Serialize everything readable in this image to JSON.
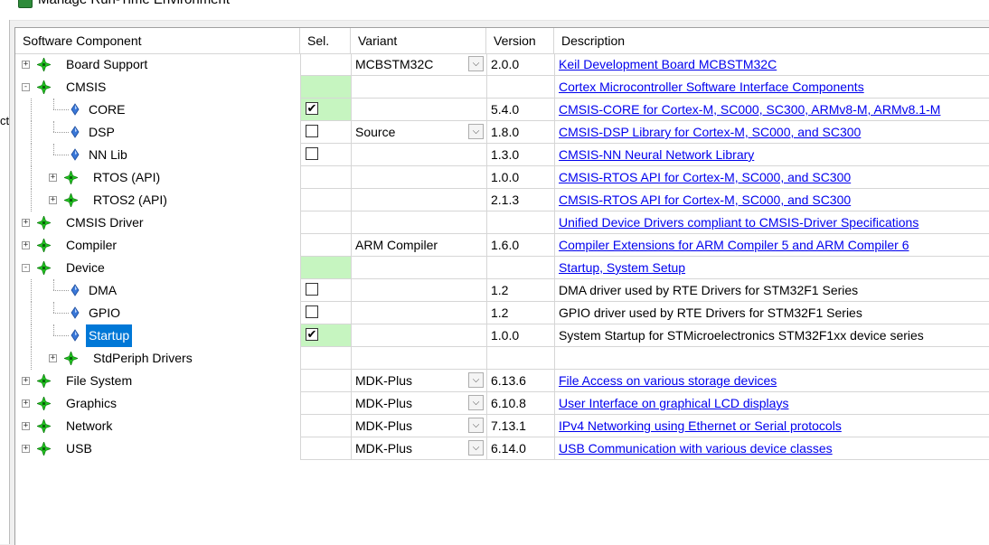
{
  "window": {
    "title": "Manage Run-Time Environment"
  },
  "left_fragment": "ct",
  "columns": {
    "component": "Software Component",
    "sel": "Sel.",
    "variant": "Variant",
    "version": "Version",
    "description": "Description"
  },
  "rows": [
    {
      "name": "Board Support",
      "level": 0,
      "type": "group",
      "expander": "+",
      "sel": "none",
      "variant": "MCBSTM32C",
      "dropdown": true,
      "version": "2.0.0",
      "description": "Keil Development Board MCBSTM32C",
      "link": true
    },
    {
      "name": "CMSIS",
      "level": 0,
      "type": "group",
      "expander": "-",
      "sel": "green",
      "variant": "",
      "dropdown": false,
      "version": "",
      "description": "Cortex Microcontroller Software Interface Components",
      "link": true
    },
    {
      "name": "CORE",
      "level": 1,
      "type": "leaf",
      "expander": "",
      "sel": "checked-green",
      "variant": "",
      "dropdown": false,
      "version": "5.4.0",
      "description": "CMSIS-CORE for Cortex-M, SC000, SC300, ARMv8-M, ARMv8.1-M",
      "link": true
    },
    {
      "name": "DSP",
      "level": 1,
      "type": "leaf",
      "expander": "",
      "sel": "unchecked",
      "variant": "Source",
      "dropdown": true,
      "version": "1.8.0",
      "description": "CMSIS-DSP Library for Cortex-M, SC000, and SC300",
      "link": true
    },
    {
      "name": "NN Lib",
      "level": 1,
      "type": "leaf",
      "expander": "",
      "sel": "unchecked",
      "variant": "",
      "dropdown": false,
      "version": "1.3.0",
      "description": "CMSIS-NN Neural Network Library",
      "link": true
    },
    {
      "name": "RTOS (API)",
      "level": 1,
      "type": "group",
      "expander": "+",
      "sel": "none",
      "variant": "",
      "dropdown": false,
      "version": "1.0.0",
      "description": "CMSIS-RTOS API for Cortex-M, SC000, and SC300",
      "link": true
    },
    {
      "name": "RTOS2 (API)",
      "level": 1,
      "type": "group",
      "expander": "+",
      "sel": "none",
      "variant": "",
      "dropdown": false,
      "version": "2.1.3",
      "description": "CMSIS-RTOS API for Cortex-M, SC000, and SC300",
      "link": true
    },
    {
      "name": "CMSIS Driver",
      "level": 0,
      "type": "group",
      "expander": "+",
      "sel": "none",
      "variant": "",
      "dropdown": false,
      "version": "",
      "description": "Unified Device Drivers compliant to CMSIS-Driver Specifications",
      "link": true
    },
    {
      "name": "Compiler",
      "level": 0,
      "type": "group",
      "expander": "+",
      "sel": "none",
      "variant": "ARM Compiler",
      "dropdown": false,
      "version": "1.6.0",
      "description": "Compiler Extensions for ARM Compiler 5 and ARM Compiler 6",
      "link": true
    },
    {
      "name": "Device",
      "level": 0,
      "type": "group",
      "expander": "-",
      "sel": "green",
      "variant": "",
      "dropdown": false,
      "version": "",
      "description": "Startup, System Setup",
      "link": true
    },
    {
      "name": "DMA",
      "level": 1,
      "type": "leaf",
      "expander": "",
      "sel": "unchecked",
      "variant": "",
      "dropdown": false,
      "version": "1.2",
      "description": "DMA driver used by RTE Drivers for STM32F1 Series",
      "link": false
    },
    {
      "name": "GPIO",
      "level": 1,
      "type": "leaf",
      "expander": "",
      "sel": "unchecked",
      "variant": "",
      "dropdown": false,
      "version": "1.2",
      "description": "GPIO driver used by RTE Drivers for STM32F1 Series",
      "link": false
    },
    {
      "name": "Startup",
      "level": 1,
      "type": "leaf",
      "expander": "",
      "sel": "checked-green",
      "variant": "",
      "dropdown": false,
      "version": "1.0.0",
      "description": "System Startup for STMicroelectronics STM32F1xx device series",
      "link": false,
      "selected": true
    },
    {
      "name": "StdPeriph Drivers",
      "level": 1,
      "type": "group",
      "expander": "+",
      "sel": "none",
      "variant": "",
      "dropdown": false,
      "version": "",
      "description": "",
      "link": false
    },
    {
      "name": "File System",
      "level": 0,
      "type": "group",
      "expander": "+",
      "sel": "none",
      "variant": "MDK-Plus",
      "dropdown": true,
      "version": "6.13.6",
      "description": "File Access on various storage devices",
      "link": true
    },
    {
      "name": "Graphics",
      "level": 0,
      "type": "group",
      "expander": "+",
      "sel": "none",
      "variant": "MDK-Plus",
      "dropdown": true,
      "version": "6.10.8",
      "description": "User Interface on graphical LCD displays",
      "link": true
    },
    {
      "name": "Network",
      "level": 0,
      "type": "group",
      "expander": "+",
      "sel": "none",
      "variant": "MDK-Plus",
      "dropdown": true,
      "version": "7.13.1",
      "description": "IPv4 Networking using Ethernet or Serial protocols",
      "link": true
    },
    {
      "name": "USB",
      "level": 0,
      "type": "group",
      "expander": "+",
      "sel": "none",
      "variant": "MDK-Plus",
      "dropdown": true,
      "version": "6.14.0",
      "description": "USB Communication with various device classes",
      "link": true
    }
  ],
  "colors": {
    "selection": "#0078d7",
    "selected_cell_green": "#c6f5c0",
    "link": "#0000ee",
    "component_green": "#22cc22"
  },
  "icons": {
    "group": "green-diamond-component-icon",
    "leaf": "blue-gem-component-icon",
    "check": "✔",
    "dropdown": "⌵"
  }
}
